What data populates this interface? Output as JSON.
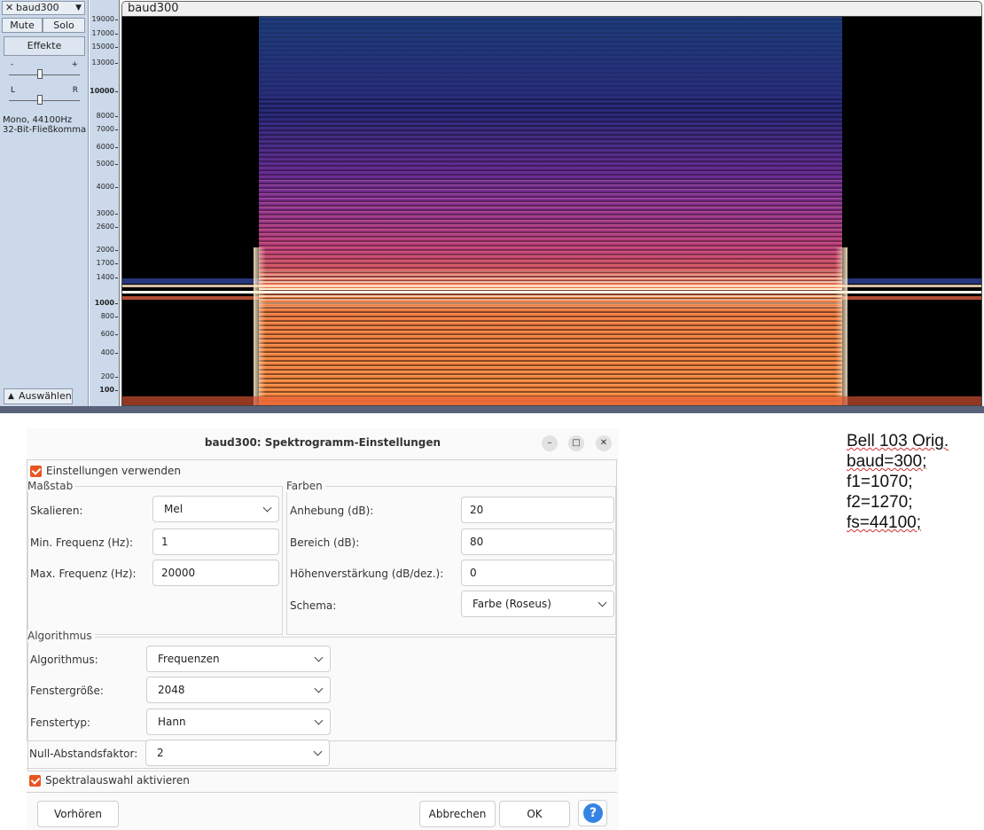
{
  "track": {
    "close_glyph": "✕",
    "name": "baud300",
    "menu_glyph": "▼",
    "mute_label": "Mute",
    "solo_label": "Solo",
    "effects_label": "Effekte",
    "gain_minus": "-",
    "gain_plus": "+",
    "pan_left": "L",
    "pan_right": "R",
    "info_line1": "Mono, 44100Hz",
    "info_line2": "32-Bit-Fließkomma",
    "select_label": "Auswählen"
  },
  "ruler": {
    "ticks": [
      "19000",
      "17000",
      "15000",
      "13000",
      "10000",
      "8000",
      "7000",
      "6000",
      "5000",
      "4000",
      "3000",
      "2600",
      "2000",
      "1700",
      "1400",
      "1000",
      "800",
      "600",
      "400",
      "200",
      "100"
    ]
  },
  "spectrogram": {
    "clip_name": "baud300",
    "tones_hz": [
      1070,
      1270
    ],
    "baud": 300,
    "colors": {
      "background": "#000000",
      "low": "#1b2a6e",
      "mid": "#9a2f9c",
      "high": "#f26f3a",
      "peak": "#fff4dd"
    }
  },
  "dialog": {
    "title": "baud300: Spektrogramm-Einstellungen",
    "minimize_glyph": "–",
    "maximize_glyph": "□",
    "close_glyph": "✕",
    "use_settings_label": "Einstellungen verwenden",
    "use_settings_checked": true,
    "scale_group": "Maßstab",
    "scale_label": "Skalieren:",
    "scale_value": "Mel",
    "min_freq_label": "Min. Frequenz (Hz):",
    "min_freq_value": "1",
    "max_freq_label": "Max. Frequenz (Hz):",
    "max_freq_value": "20000",
    "colors_group": "Farben",
    "gain_label": "Anhebung (dB):",
    "gain_value": "20",
    "range_label": "Bereich (dB):",
    "range_value": "80",
    "high_boost_label": "Höhenverstärkung (dB/dez.):",
    "high_boost_value": "0",
    "scheme_label": "Schema:",
    "scheme_value": "Farbe (Roseus)",
    "algorithm_group": "Algorithmus",
    "algorithm_label": "Algorithmus:",
    "algorithm_value": "Frequenzen",
    "window_size_label": "Fenstergröße:",
    "window_size_value": "2048",
    "window_type_label": "Fenstertyp:",
    "window_type_value": "Hann",
    "zero_padding_label": "Null-Abstandsfaktor:",
    "zero_padding_value": "2",
    "spectral_select_label": "Spektralauswahl aktivieren",
    "spectral_select_checked": true,
    "preview_button": "Vorhören",
    "cancel_button": "Abbrechen",
    "ok_button": "OK",
    "help_glyph": "?"
  },
  "notes": {
    "line1": "Bell 103 Orig.",
    "line2": "baud=300;",
    "line3": "f1=1070;",
    "line4": "f2=1270;",
    "line5": "fs=44100;"
  }
}
